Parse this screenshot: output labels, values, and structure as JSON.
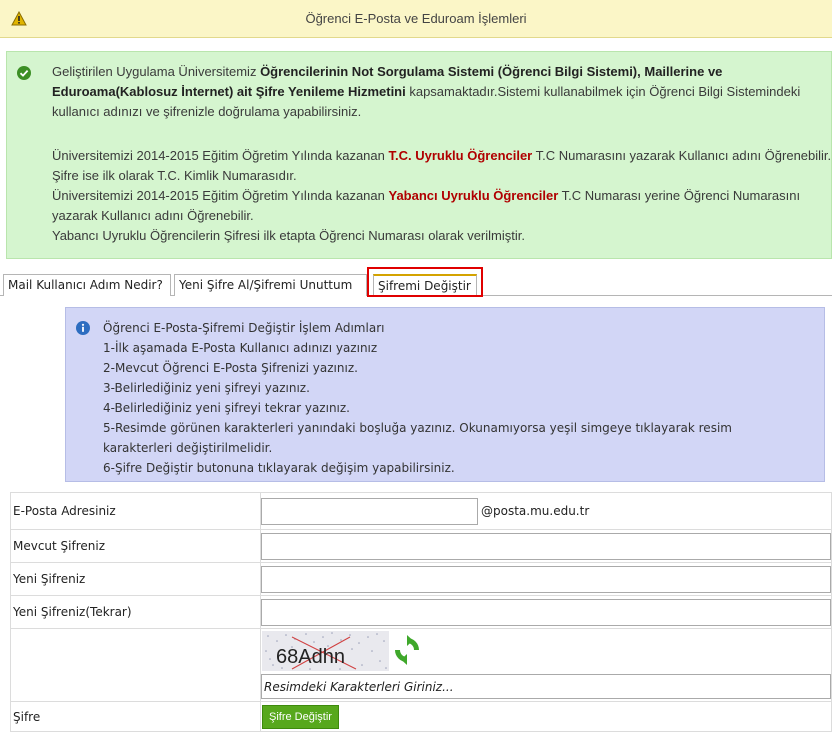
{
  "header": {
    "title": "Öğrenci E-Posta ve Eduroam İşlemleri",
    "icon": "warning-icon"
  },
  "notice": {
    "icon": "check-circle-icon",
    "p1_pre": "Geliştirilen Uygulama Üniversitemiz ",
    "p1_bold1": "Öğrencilerinin Not Sorgulama Sistemi (Öğrenci Bilgi Sistemi), Maillerine ve Eduroama(Kablosuz İnternet) ait Şifre Yenileme Hizmetini",
    "p1_post": " kapsamaktadır.Sistemi kullanabilmek için Öğrenci Bilgi Sistemindeki kullanıcı adınızı ve şifrenizle doğrulama yapabilirsiniz.",
    "p2_a": "Üniversitemizi 2014-2015 Eğitim Öğretim Yılında kazanan ",
    "p2_red": "T.C. Uyruklu Öğrenciler",
    "p2_b": " T.C Numarasını yazarak Kullanıcı adını Öğrenebilir. Şifre ise ilk olarak T.C. Kimlik Numarasıdır.",
    "p3_a": "Üniversitemizi 2014-2015 Eğitim Öğretim Yılında kazanan ",
    "p3_red": "Yabancı Uyruklu Öğrenciler",
    "p3_b": " T.C Numarası yerine Öğrenci Numarasını yazarak Kullanıcı adını Öğrenebilir.",
    "p4": "Yabancı Uyruklu Öğrencilerin Şifresi ilk etapta Öğrenci Numarası olarak verilmiştir."
  },
  "tabs": [
    {
      "label": "Mail Kullanıcı Adım Nedir?"
    },
    {
      "label": "Yeni Şifre Al/Şifremi Unuttum"
    },
    {
      "label": "Şifremi Değiştir",
      "active": true
    }
  ],
  "info": {
    "icon": "info-icon",
    "lines": [
      "Öğrenci E-Posta-Şifremi Değiştir İşlem Adımları",
      "1-İlk aşamada E-Posta Kullanıcı adınızı yazınız",
      "2-Mevcut Öğrenci E-Posta Şifrenizi yazınız.",
      "3-Belirlediğiniz yeni şifreyi yazınız.",
      "4-Belirlediğiniz yeni şifreyi tekrar yazınız.",
      "5-Resimde görünen karakterleri yanındaki boşluğa yazınız. Okunamıyorsa yeşil simgeye tıklayarak resim karakterleri değiştirilmelidir.",
      "6-Şifre Değiştir butonuna tıklayarak değişim yapabilirsiniz."
    ]
  },
  "form": {
    "email_label": "E-Posta Adresiniz",
    "email_value": "",
    "email_domain": "@posta.mu.edu.tr",
    "current_label": "Mevcut Şifreniz",
    "current_value": "",
    "new_label": "Yeni Şifreniz",
    "new_value": "",
    "repeat_label": "Yeni Şifreniz(Tekrar)",
    "repeat_value": "",
    "captcha_text": "68Adhn",
    "captcha_icon": "refresh-icon",
    "captcha_placeholder": "Resimdeki Karakterleri Giriniz...",
    "submit_row_label": "Şifre",
    "submit_button": "Şifre Değiştir"
  },
  "colors": {
    "header_bg": "#fbf6c7",
    "success_bg": "#d5f5cf",
    "info_bg": "#d2d6f6",
    "emphasis_red": "#b00000",
    "tab_highlight": "#e00000",
    "button_green": "#57a81c"
  }
}
